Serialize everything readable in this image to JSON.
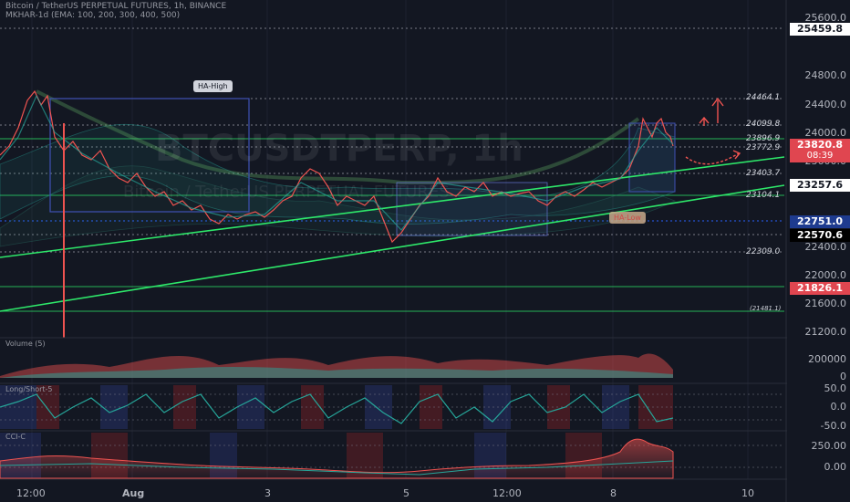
{
  "header": {
    "symbol_line": "Bitcoin / TetherUS PERPETUAL FUTURES, 1h, BINANCE",
    "indicator_line": "MKHAR-1d (EMA: 100, 200, 300, 400, 500)"
  },
  "watermark": {
    "main": "BTCUSDTPERP, 1h",
    "sub": "Bitcoin / TetherUS PERPETUAL FUTURES"
  },
  "price_axis": [
    "25600.0",
    "24800.0",
    "24400.0",
    "24000.0",
    "23600.0",
    "22400.0",
    "22000.0",
    "21600.0",
    "21200.0"
  ],
  "badges": {
    "top": "25459.8",
    "current": "23820.8",
    "countdown": "08:39",
    "level_23257": "23257.6",
    "level_22751": "22751.0",
    "level_22570": "22570.6",
    "level_21826": "21826.1"
  },
  "levels": [
    "24464.1",
    "24099.8",
    "23896.9",
    "23772.9",
    "23403.7",
    "23104.1",
    "22309.0",
    "(21481.1)"
  ],
  "callouts": {
    "ha_high": "HA-High",
    "ha_low": "HA-Low"
  },
  "panels": {
    "volume": {
      "title": "Volume (5)",
      "axis": [
        "200000",
        "0"
      ]
    },
    "long_short": {
      "title": "Long/Short-5",
      "axis": [
        "50.0",
        "0.0",
        "-50.0"
      ]
    },
    "cci": {
      "title": "CCI-C",
      "axis": [
        "250.00",
        "0.00"
      ]
    }
  },
  "time_axis": [
    "12:00",
    "Aug",
    "3",
    "5",
    "12:00",
    "8",
    "10"
  ],
  "colors": {
    "background": "#131722",
    "up": "#26a69a",
    "down": "#ef5350",
    "trendline": "#2ee86a",
    "blue_badge": "#1e3b8f",
    "red_badge": "#e04650"
  }
}
